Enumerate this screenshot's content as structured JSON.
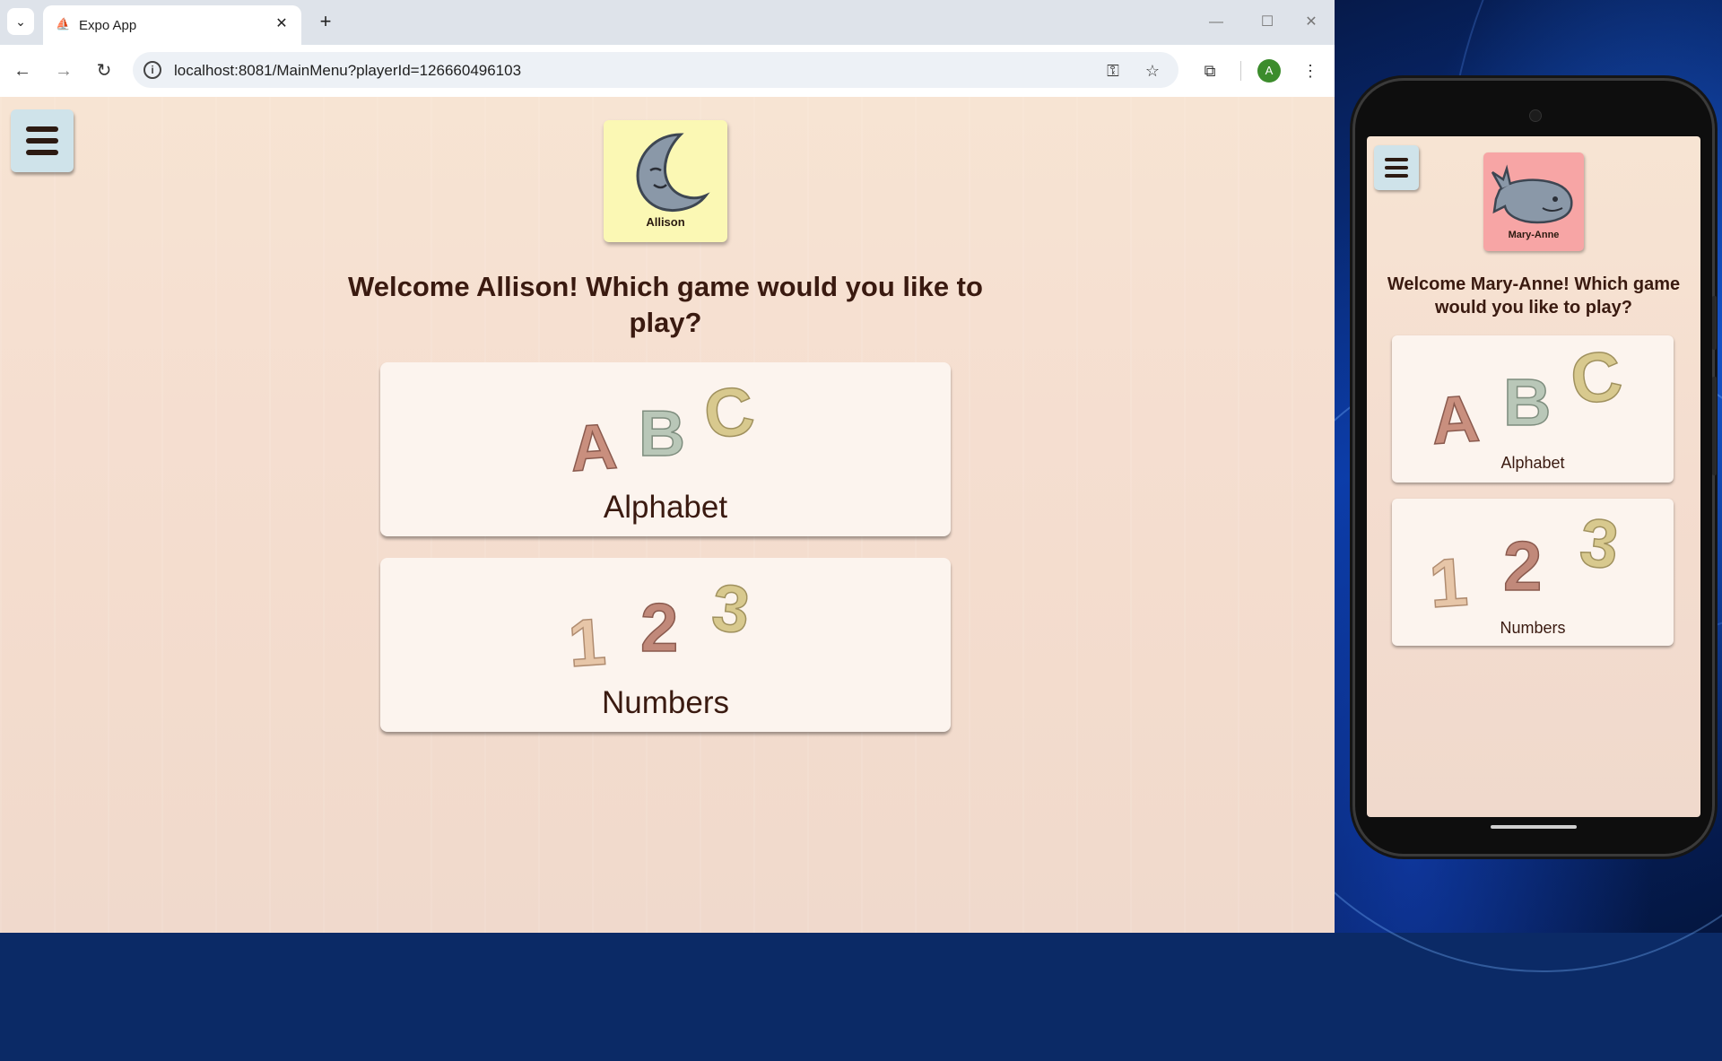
{
  "browser": {
    "tab_title": "Expo App",
    "url": "localhost:8081/MainMenu?playerId=126660496103",
    "profile_initial": "A",
    "icons": [
      "tab-list-icon",
      "close-icon",
      "new-tab-icon",
      "minimize-icon",
      "maximize-icon",
      "window-close-icon",
      "back-icon",
      "forward-icon",
      "reload-icon",
      "site-info-icon",
      "password-key-icon",
      "bookmark-star-icon",
      "extensions-icon",
      "kebab-menu-icon"
    ]
  },
  "desktop_app": {
    "player": {
      "name": "Allison",
      "icon": "moon-icon",
      "card_color": "#fbf8b4"
    },
    "welcome": "Welcome Allison! Which game would you like to play?",
    "games": [
      {
        "label": "Alphabet",
        "glyphs": [
          "A",
          "B",
          "C"
        ],
        "glyph_colors": [
          "#c98f7e",
          "#b9c7b8",
          "#d8c98e"
        ]
      },
      {
        "label": "Numbers",
        "glyphs": [
          "1",
          "2",
          "3"
        ],
        "glyph_colors": [
          "#e7c6a8",
          "#c1897a",
          "#d8c98e"
        ]
      }
    ]
  },
  "phone_app": {
    "player": {
      "name": "Mary-Anne",
      "icon": "whale-icon",
      "card_color": "#f7a5a5"
    },
    "welcome": "Welcome Mary-Anne! Which game would you like to play?",
    "games": [
      {
        "label": "Alphabet",
        "glyphs": [
          "A",
          "B",
          "C"
        ]
      },
      {
        "label": "Numbers",
        "glyphs": [
          "1",
          "2",
          "3"
        ]
      }
    ]
  }
}
